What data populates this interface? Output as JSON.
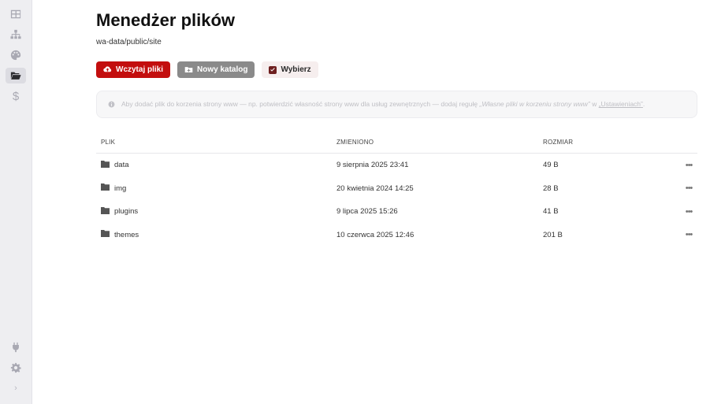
{
  "page": {
    "title": "Menedżer plików",
    "path": "wa-data/public/site"
  },
  "toolbar": {
    "upload_label": "Wczytaj pliki",
    "new_folder_label": "Nowy katalog",
    "select_label": "Wybierz"
  },
  "notice": {
    "text_before": "Aby dodać plik do korzenia strony www — np. potwierdzić własność strony www dla usług zewnętrznych — dodaj regułę ",
    "rule_name": "„Własne pliki w korzeniu strony www”",
    "text_middle": " w ",
    "link_text": "„Ustawieniach”",
    "text_after": "."
  },
  "table": {
    "headers": {
      "name": "PLIK",
      "modified": "ZMIENIONO",
      "size": "ROZMIAR"
    },
    "rows": [
      {
        "name": "data",
        "modified": "9 sierpnia 2025 23:41",
        "size": "49 B",
        "menu": "•••"
      },
      {
        "name": "img",
        "modified": "20 kwietnia 2024 14:25",
        "size": "28 B",
        "menu": "•••"
      },
      {
        "name": "plugins",
        "modified": "9 lipca 2025 15:26",
        "size": "41 B",
        "menu": "•••"
      },
      {
        "name": "themes",
        "modified": "10 czerwca 2025 12:46",
        "size": "201 B",
        "menu": "•••"
      }
    ]
  },
  "sidebar": {
    "icons": [
      "dashboard-icon",
      "sitemap-icon",
      "palette-icon",
      "folder-open-icon",
      "dollar-icon"
    ],
    "bottom_icons": [
      "plug-icon",
      "gear-icon",
      "chevron-right-icon"
    ],
    "dollar_glyph": "$",
    "chevron_glyph": "›"
  },
  "colors": {
    "primary": "#c30e0e",
    "secondary_button": "#8a8a8a",
    "sidebar_bg": "#eeeef1"
  }
}
